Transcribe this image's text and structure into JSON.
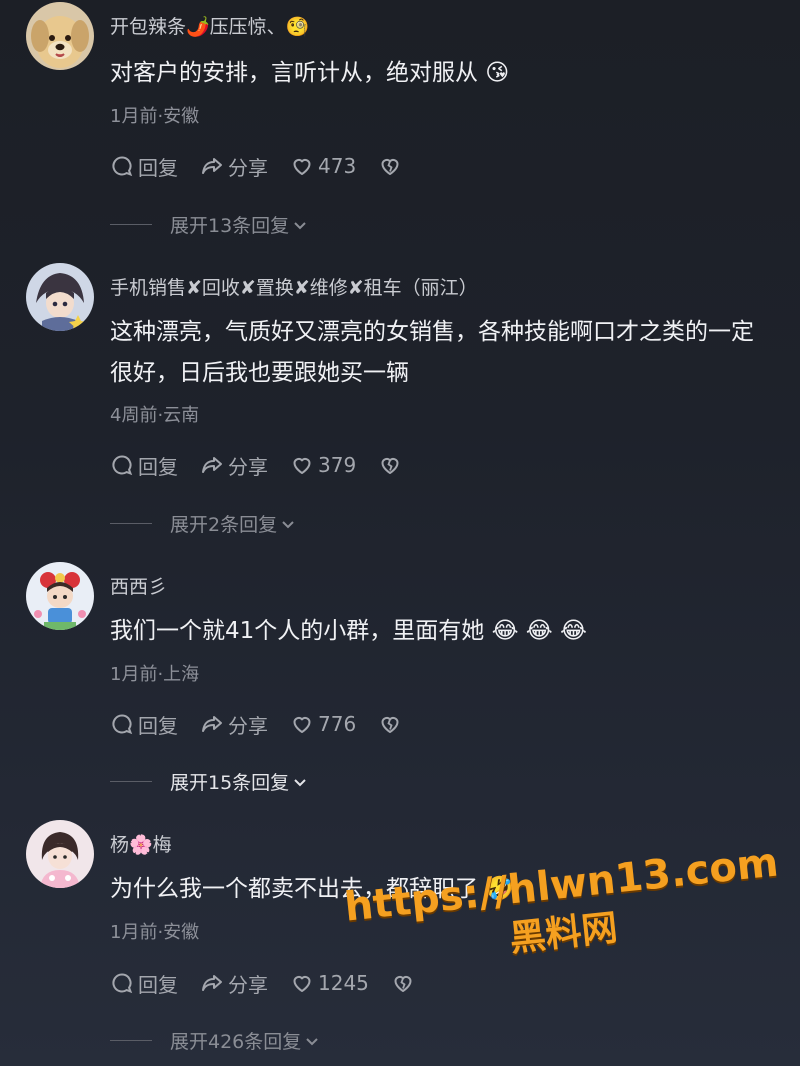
{
  "colors": {
    "accent_watermark": "#f5a020",
    "text_primary": "#f0f1f4",
    "text_secondary": "#8d9099"
  },
  "comments": [
    {
      "username": "开包辣条🌶️压压惊、🧐",
      "content": "对客户的安排，言听计从，绝对服从 😘",
      "meta": "1月前·安徽",
      "reply_label": "回复",
      "share_label": "分享",
      "likes": "473",
      "expand_label": "展开13条回复",
      "avatar_icon": "golden-retriever-avatar"
    },
    {
      "username": "手机销售✘回收✘置换✘维修✘租车（丽江）",
      "content": "这种漂亮，气质好又漂亮的女销售，各种技能啊口才之类的一定很好，日后我也要跟她买一辆",
      "meta": "4周前·云南",
      "reply_label": "回复",
      "share_label": "分享",
      "likes": "379",
      "expand_label": "展开2条回复",
      "avatar_icon": "anime-character-avatar"
    },
    {
      "username": "西西彡",
      "content": "我们一个就41个人的小群，里面有她 😂 😂 😂",
      "meta": "1月前·上海",
      "reply_label": "回复",
      "share_label": "分享",
      "likes": "776",
      "expand_label": "展开15条回复",
      "avatar_icon": "cartoon-girl-avatar"
    },
    {
      "username": "杨🌸梅",
      "content": "为什么我一个都卖不出去，都辞职了 🤣",
      "meta": "1月前·安徽",
      "reply_label": "回复",
      "share_label": "分享",
      "likes": "1245",
      "expand_label": "展开426条回复",
      "avatar_icon": "girl-photo-avatar"
    }
  ],
  "watermark": {
    "url": "https://hlwn13.com",
    "text": "黑料网"
  }
}
